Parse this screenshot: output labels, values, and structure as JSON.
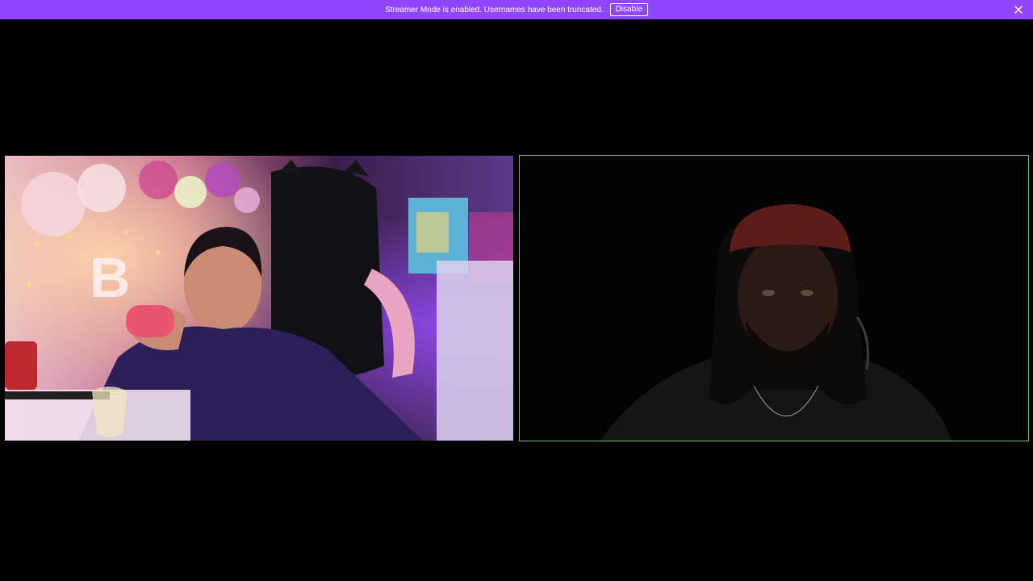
{
  "banner": {
    "message": "Streamer Mode is enabled. Usernames have been truncated.",
    "disable_label": "Disable",
    "close_icon": "close-icon",
    "background_color": "#9146ff"
  },
  "participants": [
    {
      "name": "participant-video-left",
      "speaking": false
    },
    {
      "name": "participant-video-right",
      "speaking": true,
      "speaking_border_color": "#6fbf73"
    }
  ]
}
